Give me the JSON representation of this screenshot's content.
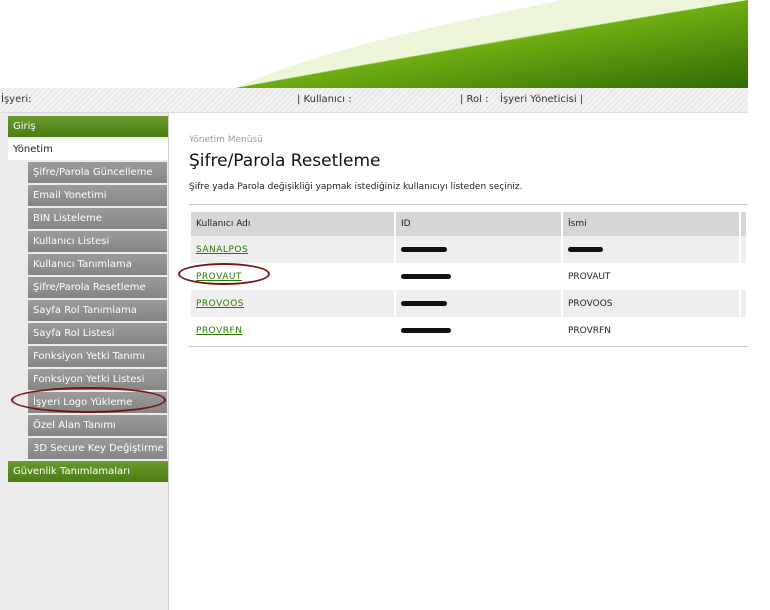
{
  "colors": {
    "brand_green": "#4a7d16",
    "link_green": "#2a7a00",
    "menu_gray": "#8e8e8e",
    "annotation_red": "#7a1414"
  },
  "infobar": {
    "merchant_label": "İşyeri:",
    "user_label": "|  Kullanıcı :",
    "role_label": "|  Rol :",
    "role_value": "İşyeri Yöneticisi |"
  },
  "sidebar": {
    "giris": "Giriş",
    "yonetim": "Yönetim",
    "items": [
      "Şifre/Parola Güncelleme",
      "Email Yonetimi",
      "BIN Listeleme",
      "Kullanıcı Listesi",
      "Kullanıcı Tanımlama",
      "Şifre/Parola Resetleme",
      "Sayfa Rol Tanımlama",
      "Sayfa Rol Listesi",
      "Fonksiyon Yetki Tanımı",
      "Fonksiyon Yetki Listesi",
      "İşyeri Logo Yükleme",
      "Özel Alan Tanımı",
      "3D Secure Key Değiştirme"
    ],
    "guvenlik": "Güvenlik Tanımlamaları"
  },
  "main": {
    "breadcrumb": "Yönetim Menüsü",
    "title": "Şifre/Parola Resetleme",
    "description": "Şifre yada Parola değişikliği yapmak istediğiniz kullanıcıyı listeden seçiniz.",
    "columns": [
      "Kullanıcı Adı",
      "ID",
      "İsmi"
    ],
    "rows": [
      {
        "username": "SANALPOS",
        "isim": ""
      },
      {
        "username": "PROVAUT",
        "isim": "PROVAUT"
      },
      {
        "username": "PROVOOS",
        "isim": "PROVOOS"
      },
      {
        "username": "PROVRFN",
        "isim": "PROVRFN"
      }
    ]
  }
}
